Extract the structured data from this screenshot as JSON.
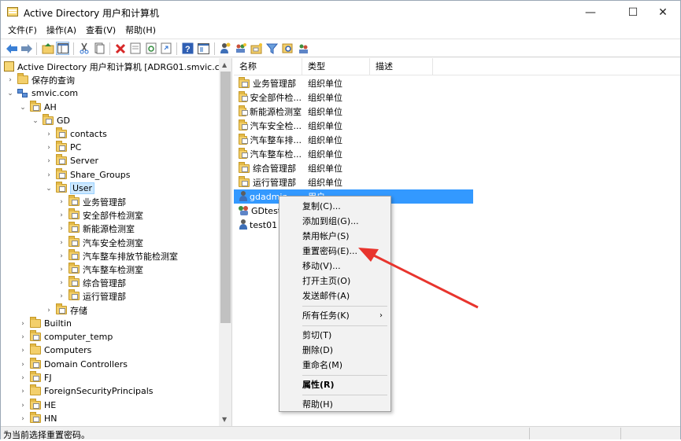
{
  "window": {
    "title": "Active Directory 用户和计算机",
    "controls": [
      "—",
      "☐",
      "✕"
    ]
  },
  "menubar": [
    "文件(F)",
    "操作(A)",
    "查看(V)",
    "帮助(H)"
  ],
  "toolbar_icons": [
    "back-arrow-icon",
    "forward-arrow-icon",
    "up-folder-icon",
    "show-tree-icon",
    "cut-icon",
    "copy-icon",
    "delete-icon",
    "properties-icon",
    "refresh-icon",
    "export-icon",
    "help-icon",
    "console-icon",
    "add-user-icon",
    "add-group-icon",
    "add-ou-icon",
    "filter-icon",
    "find-icon",
    "add-to-group-icon"
  ],
  "tree": {
    "root": "Active Directory 用户和计算机 [ADRG01.smvic.com]",
    "items": [
      {
        "label": "保存的查询"
      },
      {
        "label": "smvic.com"
      },
      {
        "label": "AH"
      },
      {
        "label": "GD"
      },
      {
        "label": "contacts"
      },
      {
        "label": "PC"
      },
      {
        "label": "Server"
      },
      {
        "label": "Share_Groups"
      },
      {
        "label": "User"
      },
      {
        "label": "业务管理部"
      },
      {
        "label": "安全部件检测室"
      },
      {
        "label": "新能源检测室"
      },
      {
        "label": "汽车安全检测室"
      },
      {
        "label": "汽车整车排放节能检测室"
      },
      {
        "label": "汽车整车检测室"
      },
      {
        "label": "综合管理部"
      },
      {
        "label": "运行管理部"
      },
      {
        "label": "存储"
      },
      {
        "label": "Builtin"
      },
      {
        "label": "computer_temp"
      },
      {
        "label": "Computers"
      },
      {
        "label": "Domain Controllers"
      },
      {
        "label": "FJ"
      },
      {
        "label": "ForeignSecurityPrincipals"
      },
      {
        "label": "HE"
      },
      {
        "label": "HN"
      }
    ]
  },
  "list": {
    "columns": [
      "名称",
      "类型",
      "描述"
    ],
    "rows": [
      {
        "name": "业务管理部",
        "type": "组织单位"
      },
      {
        "name": "安全部件检...",
        "type": "组织单位"
      },
      {
        "name": "新能源检测室",
        "type": "组织单位"
      },
      {
        "name": "汽车安全检...",
        "type": "组织单位"
      },
      {
        "name": "汽车整车排...",
        "type": "组织单位"
      },
      {
        "name": "汽车整车检...",
        "type": "组织单位"
      },
      {
        "name": "综合管理部",
        "type": "组织单位"
      },
      {
        "name": "运行管理部",
        "type": "组织单位"
      },
      {
        "name": "gdadmin",
        "type": "用户"
      },
      {
        "name": "GDtestg",
        "type": ""
      },
      {
        "name": "test01",
        "type": ""
      }
    ]
  },
  "context_menu": {
    "items": [
      "复制(C)...",
      "添加到组(G)...",
      "禁用帐户(S)",
      "重置密码(E)...",
      "移动(V)...",
      "打开主页(O)",
      "发送邮件(A)",
      "所有任务(K)",
      "剪切(T)",
      "删除(D)",
      "重命名(M)",
      "属性(R)",
      "帮助(H)"
    ],
    "submenu_marker": "›"
  },
  "status": {
    "text": "为当前选择重置密码。"
  },
  "colors": {
    "selection": "#3399ff",
    "tree_selection": "#cce8ff",
    "annotation_arrow": "#e8342d",
    "folder": "#f3cf6b"
  }
}
